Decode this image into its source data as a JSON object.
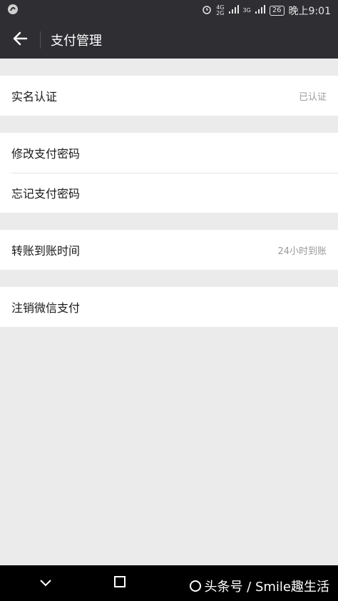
{
  "status_bar": {
    "network_top": "4G",
    "network_bottom": "2G",
    "network_3g": "3G",
    "battery": "26",
    "time": "晚上9:01"
  },
  "app_bar": {
    "title": "支付管理"
  },
  "groups": [
    {
      "rows": [
        {
          "label": "实名认证",
          "value": "已认证"
        }
      ]
    },
    {
      "rows": [
        {
          "label": "修改支付密码"
        },
        {
          "label": "忘记支付密码"
        }
      ]
    },
    {
      "rows": [
        {
          "label": "转账到账时间",
          "value": "24小时到账"
        }
      ]
    },
    {
      "rows": [
        {
          "label": "注销微信支付"
        }
      ]
    }
  ],
  "watermark": {
    "text": "头条号 / Smile趣生活"
  },
  "colors": {
    "bar_bg": "#2e2e33",
    "page_bg": "#ebebeb",
    "row_bg": "#ffffff",
    "secondary_text": "#9a9a9a"
  }
}
